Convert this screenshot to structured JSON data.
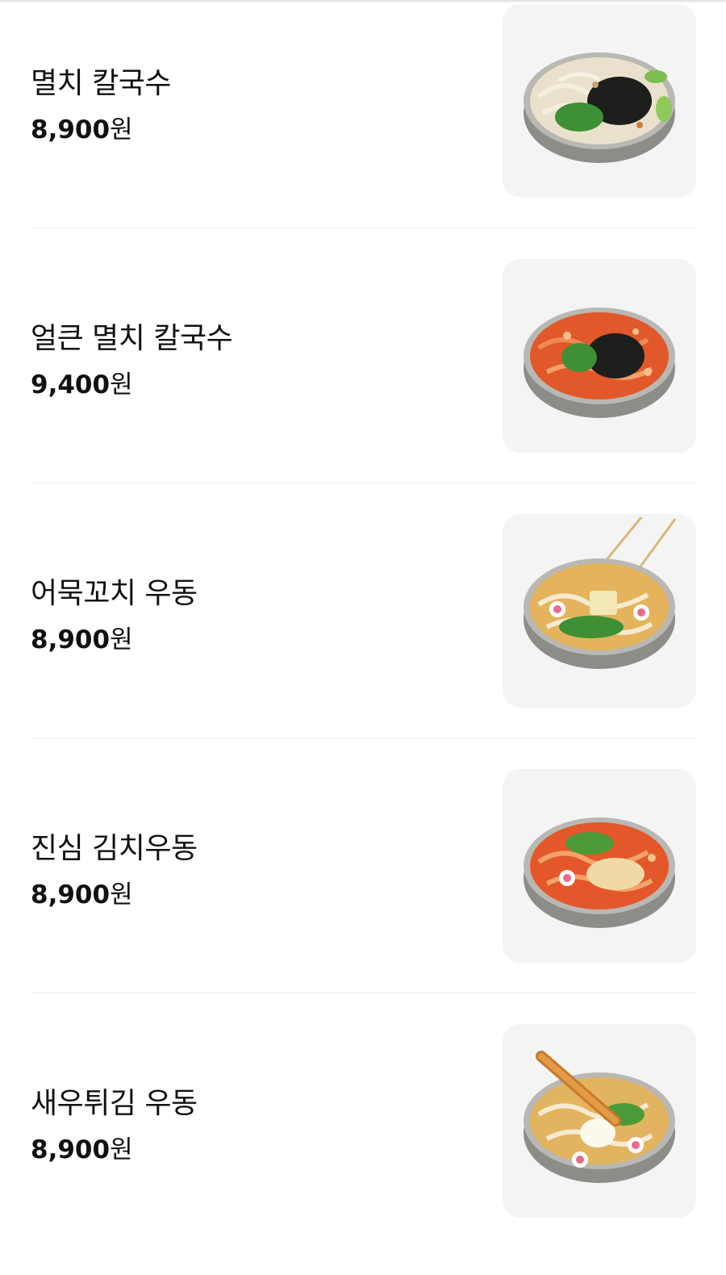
{
  "menu": {
    "items": [
      {
        "name": "멸치 칼국수",
        "price": "8,900",
        "currency": "원",
        "icon": "anchovy-kalguksu-bowl"
      },
      {
        "name": "얼큰 멸치 칼국수",
        "price": "9,400",
        "currency": "원",
        "icon": "spicy-anchovy-kalguksu-bowl"
      },
      {
        "name": "어묵꼬치 우동",
        "price": "8,900",
        "currency": "원",
        "icon": "fishcake-skewer-udon-bowl"
      },
      {
        "name": "진심 김치우동",
        "price": "8,900",
        "currency": "원",
        "icon": "kimchi-udon-bowl"
      },
      {
        "name": "새우튀김 우동",
        "price": "8,900",
        "currency": "원",
        "icon": "shrimp-tempura-udon-bowl"
      }
    ]
  },
  "colors": {
    "thumb_background": "#f4f4f5",
    "divider": "#ececec",
    "text": "#111111"
  }
}
